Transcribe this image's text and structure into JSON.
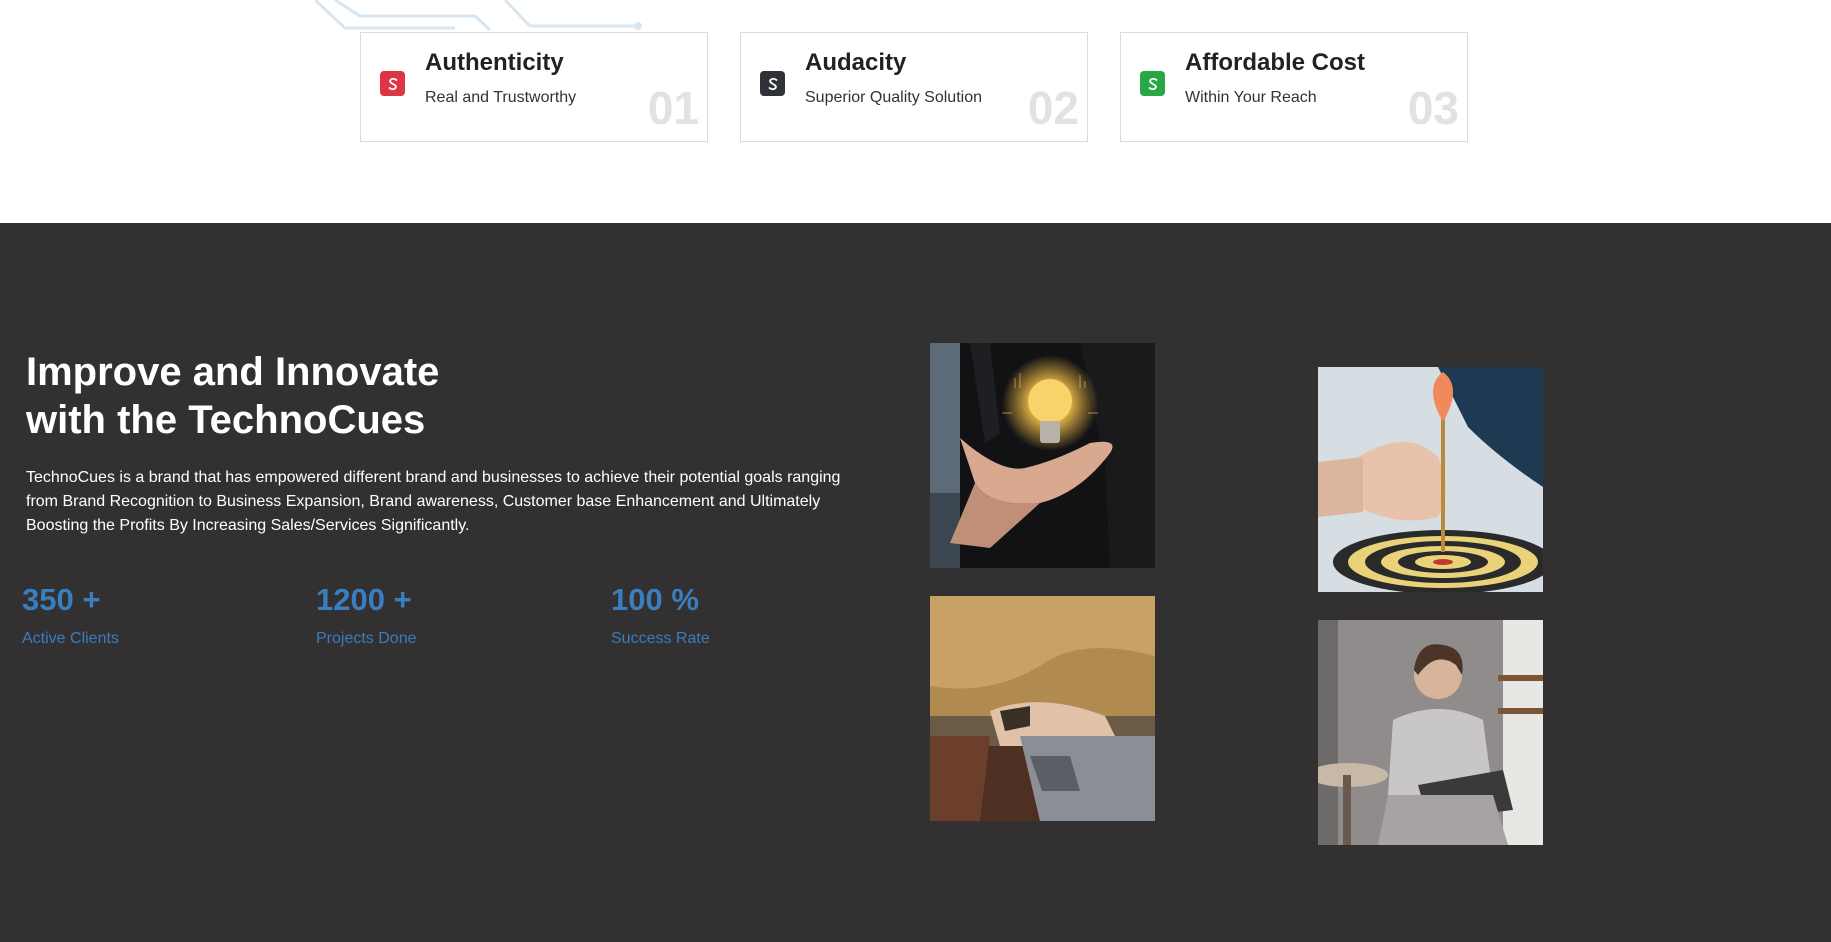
{
  "features": [
    {
      "title": "Authenticity",
      "subtitle": "Real and Trustworthy",
      "number": "01",
      "icon": "s-logo-icon",
      "color": "#dc3545"
    },
    {
      "title": "Audacity",
      "subtitle": "Superior Quality Solution",
      "number": "02",
      "icon": "s-logo-icon",
      "color": "#2f3338"
    },
    {
      "title": "Affordable Cost",
      "subtitle": "Within Your Reach",
      "number": "03",
      "icon": "s-logo-icon",
      "color": "#28a745"
    }
  ],
  "about": {
    "heading_line1": "Improve and Innovate",
    "heading_line2": "with the TechnoCues",
    "body": "TechnoCues is a brand that has empowered different brand and businesses to achieve their potential goals ranging from Brand Recognition to Business Expansion, Brand awareness, Customer base Enhancement and Ultimately Boosting the Profits By Increasing Sales/Services Significantly."
  },
  "stats": [
    {
      "value": "350 +",
      "label": "Active Clients"
    },
    {
      "value": "1200 +",
      "label": "Projects Done"
    },
    {
      "value": "100 %",
      "label": "Success Rate"
    }
  ],
  "colors": {
    "dark_bg": "#323031",
    "accent_blue": "#3a7ebf",
    "card_number": "#e2e2e2"
  }
}
